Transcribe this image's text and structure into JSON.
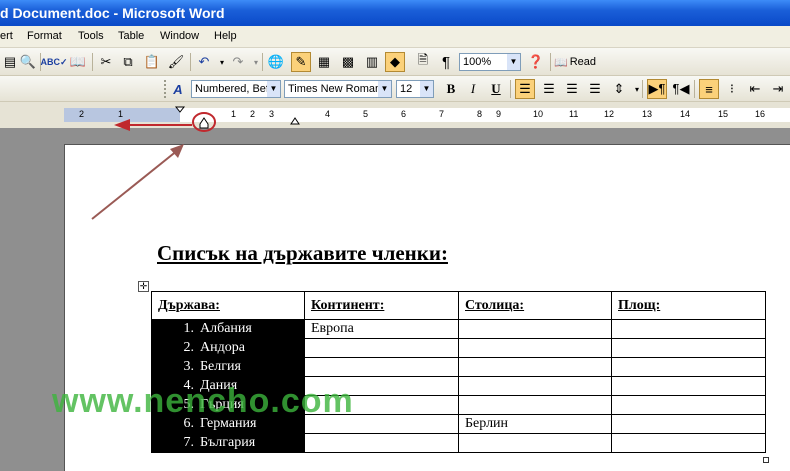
{
  "window": {
    "title": "d Document.doc - Microsoft Word"
  },
  "menu": [
    "ert",
    "Format",
    "Tools",
    "Table",
    "Window",
    "Help"
  ],
  "toolbar": {
    "zoom": "100%",
    "read_label": "Read",
    "style": "Numbered, Bef",
    "font": "Times New Roman",
    "size": "12",
    "bold": "B",
    "italic": "I",
    "underline": "U"
  },
  "ruler": {
    "ticks": [
      "2",
      "1",
      "1",
      "2",
      "3",
      "4",
      "5",
      "6",
      "7",
      "8",
      "9",
      "10",
      "11",
      "12",
      "13",
      "14",
      "15",
      "16"
    ]
  },
  "document": {
    "heading": "Списък на държавите членки:",
    "table": {
      "headers": [
        "Държава:",
        "Континент:",
        "Столица:",
        "Площ:"
      ],
      "rows": [
        {
          "num": "1.",
          "country": "Албания",
          "continent": "Европа",
          "capital": "",
          "area": ""
        },
        {
          "num": "2.",
          "country": "Андора",
          "continent": "",
          "capital": "",
          "area": ""
        },
        {
          "num": "3.",
          "country": "Белгия",
          "continent": "",
          "capital": "",
          "area": ""
        },
        {
          "num": "4.",
          "country": "Дания",
          "continent": "",
          "capital": "",
          "area": ""
        },
        {
          "num": "5.",
          "country": "Гърция",
          "continent": "",
          "capital": "",
          "area": ""
        },
        {
          "num": "6.",
          "country": "Германия",
          "continent": "",
          "capital": "Берлин",
          "area": ""
        },
        {
          "num": "7.",
          "country": "България",
          "continent": "",
          "capital": "",
          "area": ""
        }
      ]
    }
  },
  "watermark": "www.nencho.com",
  "colors": {
    "annotation": "#c0282d",
    "selection": "#000000",
    "watermark": "#3cb43c"
  }
}
